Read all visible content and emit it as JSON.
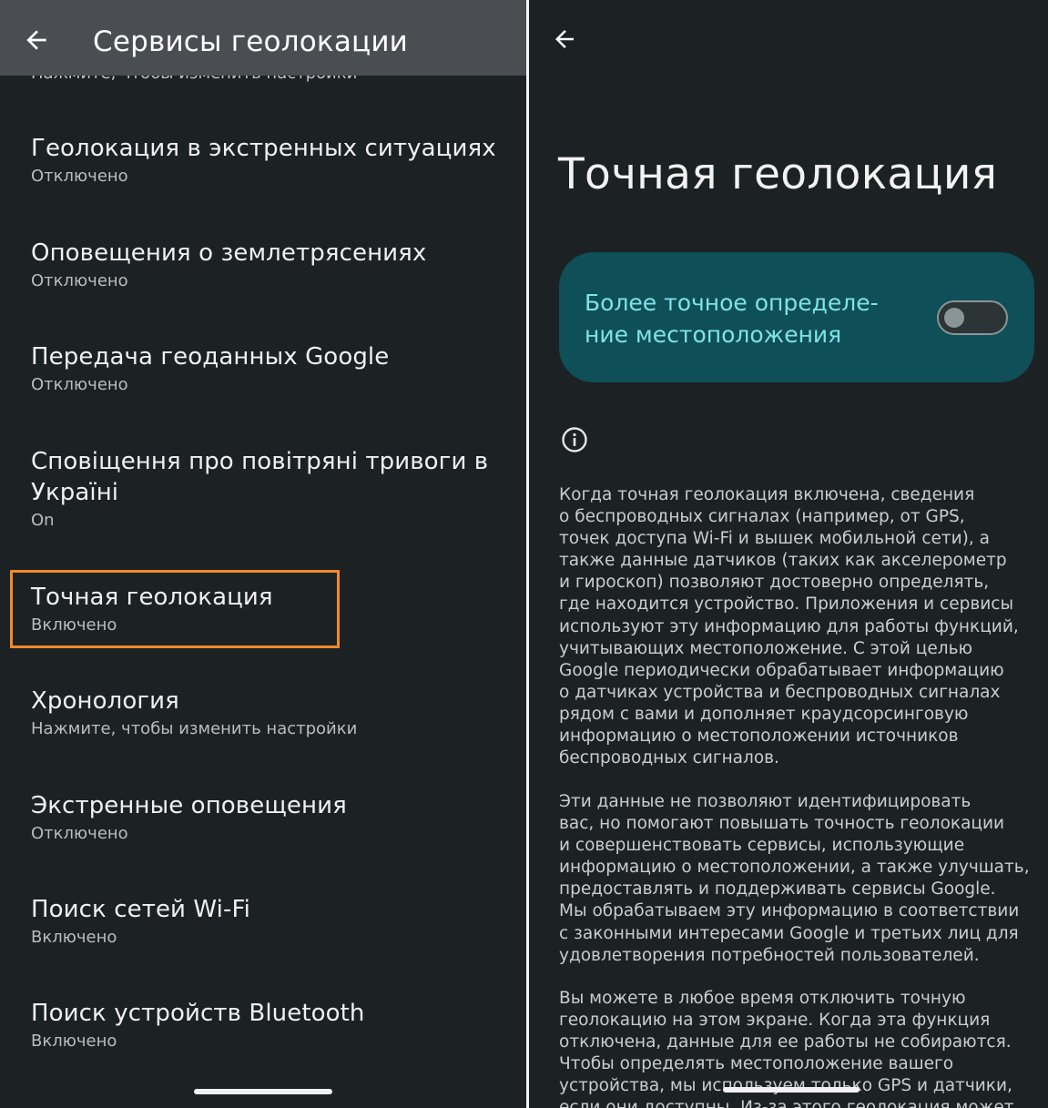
{
  "left": {
    "header": {
      "title": "Сервисы геолокации",
      "back_icon": "arrow-left-icon"
    },
    "cut_subtitle": "Нажмите, чтобы изменить настройки",
    "items": [
      {
        "title": "Геолокация в экстренных ситуациях",
        "subtitle": "Отключено"
      },
      {
        "title": "Оповещения о землетрясениях",
        "subtitle": "Отключено"
      },
      {
        "title": "Передача геоданных Google",
        "subtitle": "Отключено"
      },
      {
        "title": "Сповіщення про повітряні тривоги в\nУкраїні",
        "subtitle": "On"
      },
      {
        "title": "Точная геолокация",
        "subtitle": "Включено"
      },
      {
        "title": "Хронология",
        "subtitle": "Нажмите, чтобы изменить настройки"
      },
      {
        "title": "Экстренные оповещения",
        "subtitle": "Отключено"
      },
      {
        "title": "Поиск сетей Wi-Fi",
        "subtitle": "Включено"
      },
      {
        "title": "Поиск устройств Bluetooth",
        "subtitle": "Включено"
      }
    ],
    "highlight_color": "#f08a2a"
  },
  "right": {
    "back_icon": "arrow-left-icon",
    "title": "Точная геолокация",
    "toggle_card": {
      "label": "Более точное определе-\nние местоположения",
      "checked": false,
      "card_color": "#0f4f58",
      "label_color": "#7fe3e7"
    },
    "info_icon": "info-icon",
    "paragraphs": [
      "Когда точная геолокация включена, сведения\nо беспроводных сигналах (например, от GPS,\nточек доступа Wi-Fi и вышек мобильной сети), а\nтакже данные датчиков (таких как акселерометр\nи гироскоп) позволяют достоверно определять,\nгде находится устройство. Приложения и сервисы\nиспользуют эту информацию для работы функций,\nучитывающих местоположение. С этой целью\nGoogle периодически обрабатывает информацию\nо датчиках устройства и беспроводных сигналах\nрядом с вами и дополняет краудсорсинговую\nинформацию о местоположении источников\nбеспроводных сигналов.",
      "Эти данные не позволяют идентифицировать\nвас, но помогают повышать точность геолокации\nи совершенствовать сервисы, использующие\nинформацию о местоположении, а также улучшать,\nпредоставлять и поддерживать сервисы Google.\nМы обрабатываем эту информацию в соответствии\nс законными интересами Google и третьих лиц для\nудовлетворения потребностей пользователей.",
      "Вы можете в любое время отключить точную\nгеолокацию на этом экране. Когда эта функция\nотключена, данные для ее работы не собираются.\nЧтобы определять местоположение вашего\nустройства, мы используем только GPS и датчики,\nесли они доступны. Из-за этого геолокация может"
    ]
  }
}
